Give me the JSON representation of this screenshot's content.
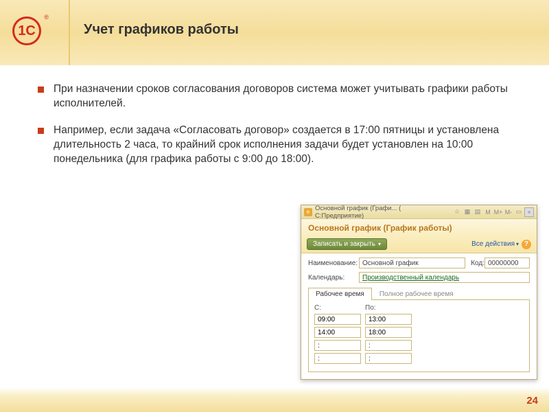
{
  "logo": {
    "text": "1С",
    "reg": "®"
  },
  "title": "Учет графиков работы",
  "bullets": [
    "При назначении сроков согласования договоров система может учитывать графики работы исполнителей.",
    "Например, если задача «Согласовать договор» создается в 17:00 пятницы и установлена длительность 2 часа, то крайний срок исполнения задачи будет установлен на 10:00 понедельника (для графика работы с 9:00 до 18:00)."
  ],
  "app": {
    "titlebar": "Основной график (Графи...  ( С:Предприятие)",
    "header": "Основной график (График работы)",
    "save_btn": "Записать и закрыть",
    "all_actions": "Все действия",
    "fields": {
      "name_label": "Наименование:",
      "name_value": "Основной график",
      "code_label": "Код:",
      "code_value": "00000000",
      "calendar_label": "Календарь:",
      "calendar_value": "Производственный календарь"
    },
    "tabs": [
      "Рабочее время",
      "Полное рабочее время"
    ],
    "time_headers": [
      "С:",
      "По:"
    ],
    "time_rows": [
      [
        "09:00",
        "13:00"
      ],
      [
        "14:00",
        "18:00"
      ],
      [
        ":",
        ":"
      ],
      [
        ":",
        ":"
      ]
    ]
  },
  "page_number": "24"
}
